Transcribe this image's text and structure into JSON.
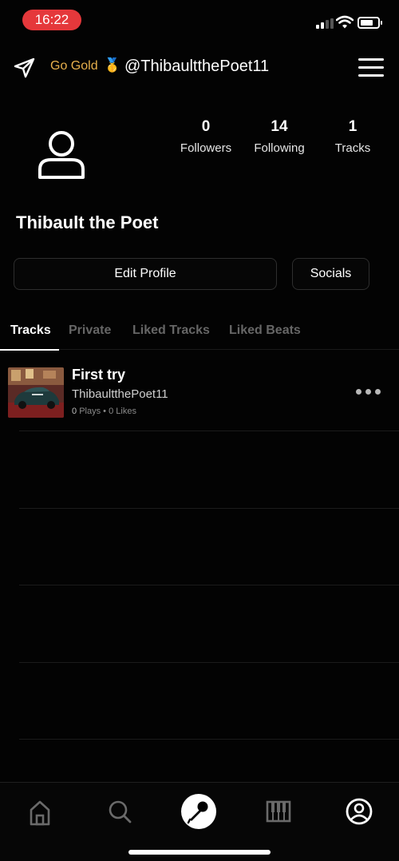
{
  "status": {
    "time": "16:22",
    "time_pill_color": "#e5383b"
  },
  "header": {
    "go_gold": "Go Gold",
    "medal": "🥇",
    "handle": "@ThibaultthePoet11",
    "send_icon": "paper-plane-icon",
    "menu_icon": "hamburger-menu-icon"
  },
  "profile": {
    "display_name": "Thibault the Poet",
    "stats": [
      {
        "value": "0",
        "label": "Followers"
      },
      {
        "value": "14",
        "label": "Following"
      },
      {
        "value": "1",
        "label": "Tracks"
      }
    ],
    "edit_label": "Edit Profile",
    "socials_label": "Socials"
  },
  "tabs": [
    {
      "label": "Tracks",
      "active": true
    },
    {
      "label": "Private",
      "active": false
    },
    {
      "label": "Liked Tracks",
      "active": false
    },
    {
      "label": "Liked Beats",
      "active": false
    }
  ],
  "tracks": [
    {
      "title": "First try",
      "artist": "ThibaultthePoet11",
      "plays": "0",
      "plays_label": "Plays",
      "likes": "0",
      "likes_label": "Likes"
    }
  ],
  "bottom_nav": [
    {
      "icon": "home-icon",
      "active": false
    },
    {
      "icon": "search-icon",
      "active": false
    },
    {
      "icon": "microphone-icon",
      "active": true
    },
    {
      "icon": "piano-icon",
      "active": false
    },
    {
      "icon": "profile-icon",
      "active": false
    }
  ],
  "colors": {
    "accent_gold": "#e7b04c",
    "background": "#030303",
    "inactive": "#666666"
  }
}
